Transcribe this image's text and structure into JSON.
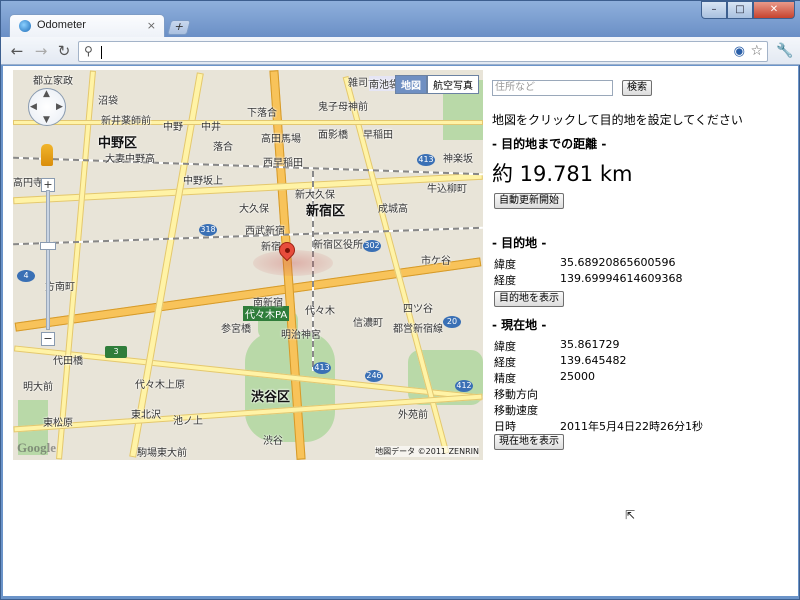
{
  "browser": {
    "tab_title": "Odometer",
    "tab_close": "×",
    "new_tab": "+",
    "win_min": "–",
    "win_max": "□",
    "win_close": "✕",
    "back": "←",
    "forward": "→",
    "reload": "↻",
    "omnibox_value": "",
    "search_glyph": "⚲",
    "icons": [
      "back-icon",
      "forward-icon",
      "reload-icon",
      "search-icon",
      "star-icon",
      "wrench-icon"
    ]
  },
  "map": {
    "type_buttons": [
      "地図",
      "航空写真"
    ],
    "active_type": "地図",
    "zoom_plus": "+",
    "zoom_minus": "−",
    "google_logo": "Google",
    "copyright": "地図データ ©2011 ZENRIN",
    "labels_big": [
      "中野区",
      "新宿区",
      "渋谷区"
    ],
    "labels": [
      "都立家政",
      "沼袋",
      "中野",
      "中井",
      "下落合",
      "鬼子母神前",
      "雑司が谷",
      "南池袋",
      "新井薬師前",
      "落合",
      "高田馬場",
      "面影橋",
      "早稲田",
      "大妻中野高",
      "中野坂上",
      "西早稲田",
      "大久保",
      "新大久保",
      "成城高",
      "高円寺",
      "新宿区役所",
      "西武新宿",
      "新宿",
      "市ケ谷",
      "四ツ谷",
      "方南町",
      "代々木PA",
      "南新宿",
      "代々木",
      "参宮橋",
      "信濃町",
      "東北沢",
      "代々木上原",
      "渋谷",
      "明治神宮",
      "代田橋",
      "池ノ上",
      "駒場東大前",
      "明大前",
      "東松原",
      "外苑前",
      "都営新宿線",
      "牛込柳町",
      "神楽坂"
    ],
    "shields": [
      "4",
      "302",
      "318",
      "413",
      "413",
      "246",
      "20",
      "3",
      "412"
    ]
  },
  "panel": {
    "address_placeholder": "住所など",
    "search_button": "検索",
    "instruction": "地図をクリックして目的地を設定してください",
    "distance_heading": "- 目的地までの距離 -",
    "distance_value": "約 19.781 km",
    "auto_update_button": "自動更新開始",
    "destination_heading": "- 目的地 -",
    "destination": {
      "lat_label": "緯度",
      "lat": "35.68920865600596",
      "lng_label": "経度",
      "lng": "139.69994614609368"
    },
    "show_destination_button": "目的地を表示",
    "current_heading": "- 現在地 -",
    "current": {
      "lat_label": "緯度",
      "lat": "35.861729",
      "lng_label": "経度",
      "lng": "139.645482",
      "accuracy_label": "精度",
      "accuracy": "25000",
      "heading_label": "移動方向",
      "heading": "",
      "speed_label": "移動速度",
      "speed": "",
      "datetime_label": "日時",
      "datetime": "2011年5月4日22時26分1秒"
    },
    "show_current_button": "現在地を表示"
  }
}
